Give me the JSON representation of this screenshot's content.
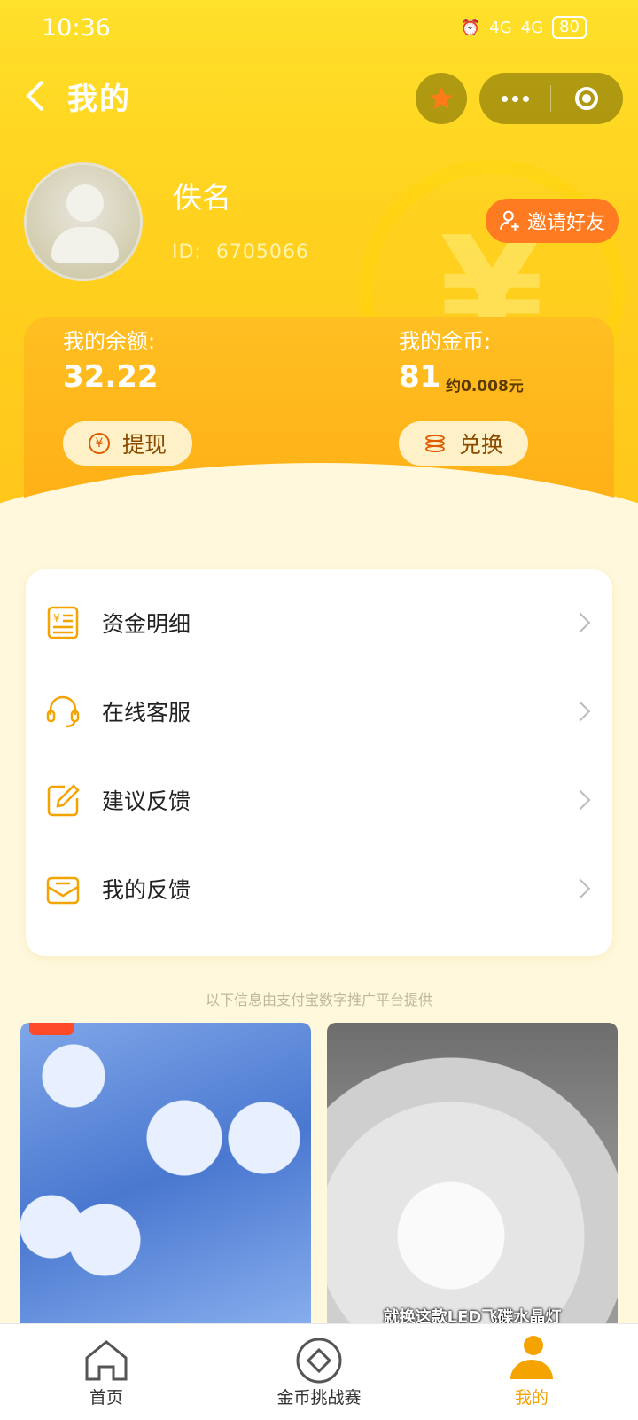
{
  "status_bar": {
    "time": "10:36",
    "signal_1": "4G",
    "signal_2": "4G",
    "battery": "80"
  },
  "nav": {
    "title": "我的"
  },
  "profile": {
    "name": "佚名",
    "id_label": "ID:",
    "id_value": "6705066",
    "invite_label": "邀请好友"
  },
  "wallet": {
    "balance_label": "我的余额:",
    "balance_value": "32.22",
    "withdraw_label": "提现",
    "coins_label": "我的金币:",
    "coins_value": "81",
    "coins_approx": "约0.008元",
    "exchange_label": "兑换"
  },
  "menu": [
    {
      "label": "资金明细",
      "icon": "receipt-icon"
    },
    {
      "label": "在线客服",
      "icon": "headset-icon"
    },
    {
      "label": "建议反馈",
      "icon": "edit-icon"
    },
    {
      "label": "我的反馈",
      "icon": "inbox-icon"
    }
  ],
  "notice": "以下信息由支付宝数字推广平台提供",
  "products": [
    {
      "caption": ""
    },
    {
      "caption": "就换这款LED飞碟水晶灯"
    }
  ],
  "tabbar": [
    {
      "label": "首页",
      "icon": "home-icon"
    },
    {
      "label": "金币挑战赛",
      "icon": "diamond-icon"
    },
    {
      "label": "我的",
      "icon": "user-icon",
      "active": true
    }
  ],
  "colors": {
    "primary": "#ffd21f",
    "accent": "#ff7b21",
    "active_tab": "#f5a300"
  }
}
